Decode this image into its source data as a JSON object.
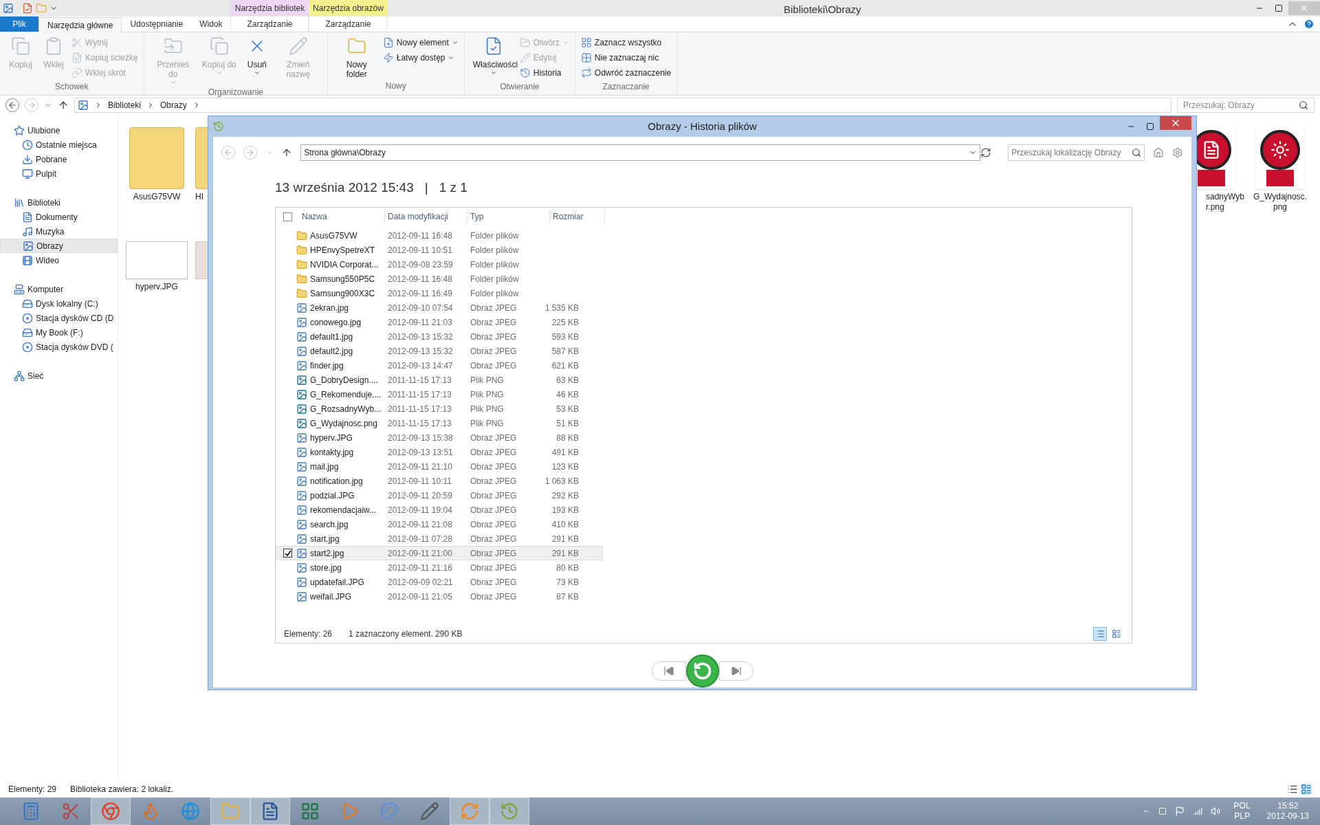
{
  "window": {
    "title": "Biblioteki\\Obrazy"
  },
  "ribbon": {
    "tabs": [
      {
        "label": "Plik",
        "kind": "file",
        "selected": false
      },
      {
        "label": "Narzędzia główne",
        "kind": "tab",
        "selected": true
      },
      {
        "label": "Udostępnianie",
        "kind": "tab",
        "selected": false
      },
      {
        "label": "Widok",
        "kind": "tab",
        "selected": false
      }
    ],
    "context_tabs": [
      {
        "group": "Narzędzia bibliotek",
        "label": "Zarządzanie",
        "color": "#eed7f3"
      },
      {
        "group": "Narzędzia obrazów",
        "label": "Zarządzanie",
        "color": "#f3f08f"
      }
    ],
    "groups": [
      {
        "label": "Schowek",
        "items": [
          {
            "label": "Kopiuj",
            "kind": "large",
            "disabled": true,
            "dropdown": false
          },
          {
            "label": "Wklej",
            "kind": "large",
            "disabled": true,
            "dropdown": false
          },
          {
            "label": "Wytnij",
            "kind": "small",
            "disabled": true,
            "dropdown": false
          },
          {
            "label": "Kopiuj ścieżkę",
            "kind": "small",
            "disabled": true,
            "dropdown": false
          },
          {
            "label": "Wklej skrót",
            "kind": "small",
            "disabled": true,
            "dropdown": false
          }
        ]
      },
      {
        "label": "Organizowanie",
        "items": [
          {
            "label": "Przenieś do",
            "kind": "large",
            "disabled": true,
            "dropdown": true
          },
          {
            "label": "Kopiuj do",
            "kind": "large",
            "disabled": true,
            "dropdown": true
          },
          {
            "label": "Usuń",
            "kind": "large",
            "disabled": false,
            "dropdown": true
          },
          {
            "label": "Zmień nazwę",
            "kind": "large",
            "disabled": true,
            "dropdown": false
          }
        ]
      },
      {
        "label": "Nowy",
        "items": [
          {
            "label": "Nowy folder",
            "kind": "large",
            "disabled": false,
            "dropdown": false
          },
          {
            "label": "Nowy element",
            "kind": "small",
            "disabled": false,
            "dropdown": true
          },
          {
            "label": "Łatwy dostęp",
            "kind": "small",
            "disabled": false,
            "dropdown": true
          }
        ]
      },
      {
        "label": "Otwieranie",
        "items": [
          {
            "label": "Właściwości",
            "kind": "large",
            "disabled": false,
            "dropdown": true
          },
          {
            "label": "Otwórz",
            "kind": "small",
            "disabled": true,
            "dropdown": true
          },
          {
            "label": "Edytuj",
            "kind": "small",
            "disabled": true,
            "dropdown": false
          },
          {
            "label": "Historia",
            "kind": "small",
            "disabled": false,
            "dropdown": false
          }
        ]
      },
      {
        "label": "Zaznaczanie",
        "items": [
          {
            "label": "Zaznacz wszystko",
            "kind": "small",
            "disabled": false,
            "dropdown": false
          },
          {
            "label": "Nie zaznaczaj nic",
            "kind": "small",
            "disabled": false,
            "dropdown": false
          },
          {
            "label": "Odwróć zaznaczenie",
            "kind": "small",
            "disabled": false,
            "dropdown": false
          }
        ]
      }
    ]
  },
  "address": {
    "path": [
      "Biblioteki",
      "Obrazy"
    ],
    "search_placeholder": "Przeszukaj: Obrazy"
  },
  "nav": [
    {
      "label": "Ulubione",
      "selected": false,
      "children": [
        {
          "label": "Ostatnie miejsca",
          "selected": false
        },
        {
          "label": "Pobrane",
          "selected": false
        },
        {
          "label": "Pulpit",
          "selected": false
        }
      ]
    },
    {
      "label": "Biblioteki",
      "selected": false,
      "children": [
        {
          "label": "Dokumenty",
          "selected": false
        },
        {
          "label": "Muzyka",
          "selected": false
        },
        {
          "label": "Obrazy",
          "selected": true
        },
        {
          "label": "Wideo",
          "selected": false
        }
      ]
    },
    {
      "label": "Komputer",
      "selected": false,
      "children": [
        {
          "label": "Dysk lokalny (C:)",
          "selected": false
        },
        {
          "label": "Stacja dysków CD (D",
          "selected": false
        },
        {
          "label": "My Book (F:)",
          "selected": false
        },
        {
          "label": "Stacja dysków DVD (",
          "selected": false
        }
      ]
    },
    {
      "label": "Sieć",
      "selected": false
    }
  ],
  "files_left": [
    {
      "name": "AsusG75VW",
      "kind": "folder"
    },
    {
      "name": "HI",
      "kind": "folder"
    },
    {
      "name": "hyperv.JPG",
      "kind": "screenshot"
    },
    {
      "kind": "photo"
    }
  ],
  "files_right": [
    {
      "name": "sadnyWybr.png",
      "kind": "badge-tag"
    },
    {
      "name": "G_Wydajnosc.png",
      "kind": "badge-gauge"
    }
  ],
  "history": {
    "title": "Obrazy - Historia plików",
    "path": "Strona główna\\Obrazy",
    "search_placeholder": "Przeszukaj lokalizację Obrazy",
    "date": "13 września 2012 15:43",
    "separator": "|",
    "position": "1 z 1",
    "select_all": false,
    "columns": [
      "Nazwa",
      "Data modyfikacji",
      "Typ",
      "Rozmiar"
    ],
    "rows": [
      {
        "name": "AsusG75VW",
        "date": "2012-09-11 16:48",
        "type": "Folder plików",
        "kind": "folder",
        "selected": false
      },
      {
        "name": "HPEnvySpetreXT",
        "date": "2012-09-11 10:51",
        "type": "Folder plików",
        "kind": "folder",
        "selected": false
      },
      {
        "name": "NVIDIA Corporat...",
        "date": "2012-09-08 23:59",
        "type": "Folder plików",
        "kind": "folder",
        "selected": false
      },
      {
        "name": "Samsung550P5C",
        "date": "2012-09-11 16:48",
        "type": "Folder plików",
        "kind": "folder",
        "selected": false
      },
      {
        "name": "Samsung900X3C",
        "date": "2012-09-11 16:49",
        "type": "Folder plików",
        "kind": "folder",
        "selected": false
      },
      {
        "name": "2ekran.jpg",
        "date": "2012-09-10 07:54",
        "type": "Obraz JPEG",
        "size": "1 535 KB",
        "kind": "jpeg",
        "selected": false
      },
      {
        "name": "conowego.jpg",
        "date": "2012-09-11 21:03",
        "type": "Obraz JPEG",
        "size": "225 KB",
        "kind": "jpeg",
        "selected": false
      },
      {
        "name": "default1.jpg",
        "date": "2012-09-13 15:32",
        "type": "Obraz JPEG",
        "size": "593 KB",
        "kind": "jpeg",
        "selected": false
      },
      {
        "name": "default2.jpg",
        "date": "2012-09-13 15:32",
        "type": "Obraz JPEG",
        "size": "587 KB",
        "kind": "jpeg",
        "selected": false
      },
      {
        "name": "finder.jpg",
        "date": "2012-09-13 14:47",
        "type": "Obraz JPEG",
        "size": "621 KB",
        "kind": "jpeg",
        "selected": false
      },
      {
        "name": "G_DobryDesign....",
        "date": "2011-11-15 17:13",
        "type": "Plik PNG",
        "size": "63 KB",
        "kind": "png",
        "selected": false
      },
      {
        "name": "G_Rekomenduje....",
        "date": "2011-11-15 17:13",
        "type": "Plik PNG",
        "size": "46 KB",
        "kind": "png",
        "selected": false
      },
      {
        "name": "G_RozsadnyWyb...",
        "date": "2011-11-15 17:13",
        "type": "Plik PNG",
        "size": "53 KB",
        "kind": "png",
        "selected": false
      },
      {
        "name": "G_Wydajnosc.png",
        "date": "2011-11-15 17:13",
        "type": "Plik PNG",
        "size": "51 KB",
        "kind": "png",
        "selected": false
      },
      {
        "name": "hyperv.JPG",
        "date": "2012-09-13 15:38",
        "type": "Obraz JPEG",
        "size": "88 KB",
        "kind": "jpeg",
        "selected": false
      },
      {
        "name": "kontakty.jpg",
        "date": "2012-09-13 13:51",
        "type": "Obraz JPEG",
        "size": "491 KB",
        "kind": "jpeg",
        "selected": false
      },
      {
        "name": "mail.jpg",
        "date": "2012-09-11 21:10",
        "type": "Obraz JPEG",
        "size": "123 KB",
        "kind": "jpeg",
        "selected": false
      },
      {
        "name": "notification.jpg",
        "date": "2012-09-11 10:11",
        "type": "Obraz JPEG",
        "size": "1 063 KB",
        "kind": "jpeg",
        "selected": false
      },
      {
        "name": "podzial.JPG",
        "date": "2012-09-11 20:59",
        "type": "Obraz JPEG",
        "size": "292 KB",
        "kind": "jpeg",
        "selected": false
      },
      {
        "name": "rekomendacjaiw...",
        "date": "2012-09-11 19:04",
        "type": "Obraz JPEG",
        "size": "193 KB",
        "kind": "jpeg",
        "selected": false
      },
      {
        "name": "search.jpg",
        "date": "2012-09-11 21:08",
        "type": "Obraz JPEG",
        "size": "410 KB",
        "kind": "jpeg",
        "selected": false
      },
      {
        "name": "start.jpg",
        "date": "2012-09-11 07:28",
        "type": "Obraz JPEG",
        "size": "291 KB",
        "kind": "jpeg",
        "selected": false
      },
      {
        "name": "start2.jpg",
        "date": "2012-09-11 21:00",
        "type": "Obraz JPEG",
        "size": "291 KB",
        "kind": "jpeg",
        "selected": true
      },
      {
        "name": "store.jpg",
        "date": "2012-09-11 21:16",
        "type": "Obraz JPEG",
        "size": "80 KB",
        "kind": "jpeg",
        "selected": false
      },
      {
        "name": "updatefail.JPG",
        "date": "2012-09-09 02:21",
        "type": "Obraz JPEG",
        "size": "73 KB",
        "kind": "jpeg",
        "selected": false
      },
      {
        "name": "weifail.JPG",
        "date": "2012-09-11 21:05",
        "type": "Obraz JPEG",
        "size": "87 KB",
        "kind": "jpeg",
        "selected": false
      }
    ],
    "status": {
      "count": "Elementy: 26",
      "selection": "1 zaznaczony element. 290 KB"
    },
    "views": [
      {
        "kind": "details",
        "selected": true
      },
      {
        "kind": "icons",
        "selected": false
      }
    ]
  },
  "status_bar": {
    "count": "Elementy: 29",
    "info": "Biblioteka zawiera: 2 lokaliz."
  },
  "taskbar": {
    "apps": [
      {
        "kind": "calculator",
        "active": false
      },
      {
        "kind": "snipping",
        "active": false
      },
      {
        "kind": "chrome",
        "active": true
      },
      {
        "kind": "firefox",
        "active": false
      },
      {
        "kind": "ie",
        "active": false
      },
      {
        "kind": "explorer",
        "active": true
      },
      {
        "kind": "word",
        "active": true
      },
      {
        "kind": "excel",
        "active": false
      },
      {
        "kind": "media",
        "active": false
      },
      {
        "kind": "paint",
        "active": false
      },
      {
        "kind": "gimp",
        "active": false
      },
      {
        "kind": "orange",
        "active": true
      },
      {
        "kind": "filehistory",
        "active": true
      }
    ],
    "language": "POL",
    "layout": "PLP",
    "time": "15:52",
    "date": "2012-09-13"
  }
}
